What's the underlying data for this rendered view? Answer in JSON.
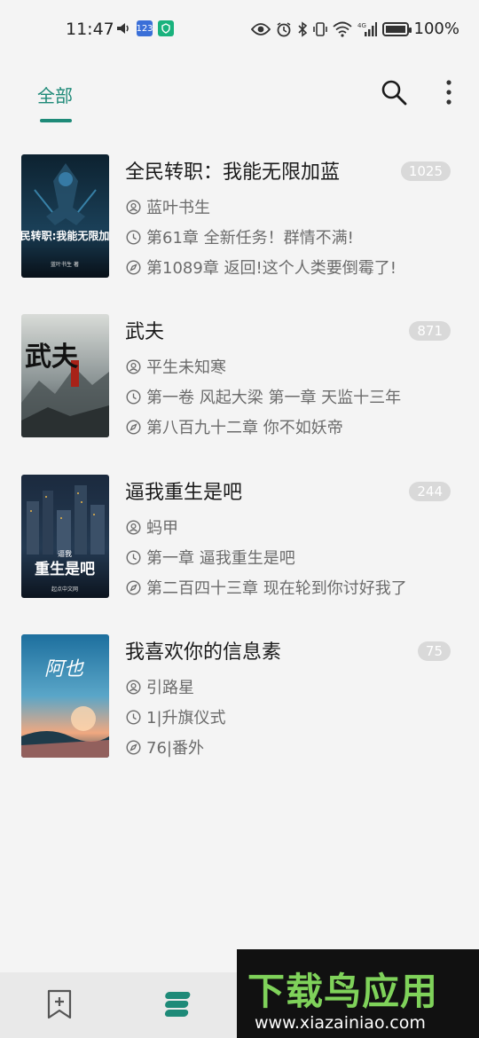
{
  "status_bar": {
    "time": "11:47",
    "chip_123": "123",
    "network": "4G",
    "battery_level": 1.0,
    "battery_text": "100%"
  },
  "header": {
    "tab_label": "全部",
    "accent_color": "#1e8a78"
  },
  "books": [
    {
      "title": "全民转职：我能无限加蓝",
      "count": "1025",
      "author": "蓝叶书生",
      "last_read": "第61章 全新任务！群情不满!",
      "latest": "第1089章 返回!这个人类要倒霉了!",
      "cover_text": "全民转职:我能无限加蓝",
      "cover_sub": "蓝叶书生 著"
    },
    {
      "title": "武夫",
      "count": "871",
      "author": "平生未知寒",
      "last_read": "第一卷 风起大梁 第一章 天监十三年",
      "latest": "第八百九十二章 你不如妖帝",
      "cover_text": "武夫"
    },
    {
      "title": "逼我重生是吧",
      "count": "244",
      "author": "蚂甲",
      "last_read": "第一章 逼我重生是吧",
      "latest": "第二百四十三章 现在轮到你讨好我了",
      "cover_text": "重生是吧",
      "cover_small": "逼我",
      "cover_sub": "起点中文网"
    },
    {
      "title": "我喜欢你的信息素",
      "count": "75",
      "author": "引路星",
      "last_read": "1|升旗仪式",
      "latest": "76|番外",
      "cover_text": "阿也"
    }
  ],
  "watermark": {
    "big": "下载鸟应用",
    "small": "www.xiazainiao.com"
  }
}
